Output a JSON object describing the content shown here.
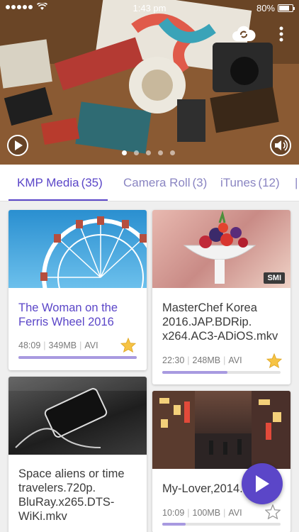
{
  "status_bar": {
    "time": "1:43 pm",
    "battery": "80%",
    "battery_level": 0.8,
    "signal_dots": 5
  },
  "hero": {
    "slides": 5,
    "active_slide": 1,
    "play_icon": "play-circle-icon",
    "volume_icon": "volume-icon",
    "cloud_icon": "cloud-sync-icon",
    "menu_icon": "more-vertical-icon"
  },
  "tabs": [
    {
      "label": "KMP Media",
      "count": "(35)",
      "active": true
    },
    {
      "label": "Camera Roll",
      "count": "(3)",
      "active": false
    },
    {
      "label": "iTunes",
      "count": "(12)",
      "active": false
    }
  ],
  "cards": [
    {
      "title": "The Woman on the Ferris Wheel 2016",
      "duration": "48:09",
      "size": "349MB",
      "format": "AVI",
      "progress": 1.0,
      "starred": true,
      "badge": ""
    },
    {
      "title": "MasterChef Korea 2016.JAP.BDRip. x264.AC3-ADiOS.mkv",
      "duration": "22:30",
      "size": "248MB",
      "format": "AVI",
      "progress": 0.55,
      "starred": true,
      "badge": "SMI"
    },
    {
      "title": "Space aliens or time travelers.720p. BluRay.x265.DTS- WiKi.mkv",
      "duration": "",
      "size": "",
      "format": "",
      "progress": 0,
      "starred": false,
      "badge": ""
    },
    {
      "title": "My-Lover,2014.mkv",
      "duration": "10:09",
      "size": "100MB",
      "format": "AVI",
      "progress": 0.2,
      "starred": false,
      "badge": ""
    }
  ],
  "fab_icon": "play-icon",
  "colors": {
    "accent": "#5b46c8",
    "star": "#f6c344",
    "progress": "#a89ae0"
  }
}
